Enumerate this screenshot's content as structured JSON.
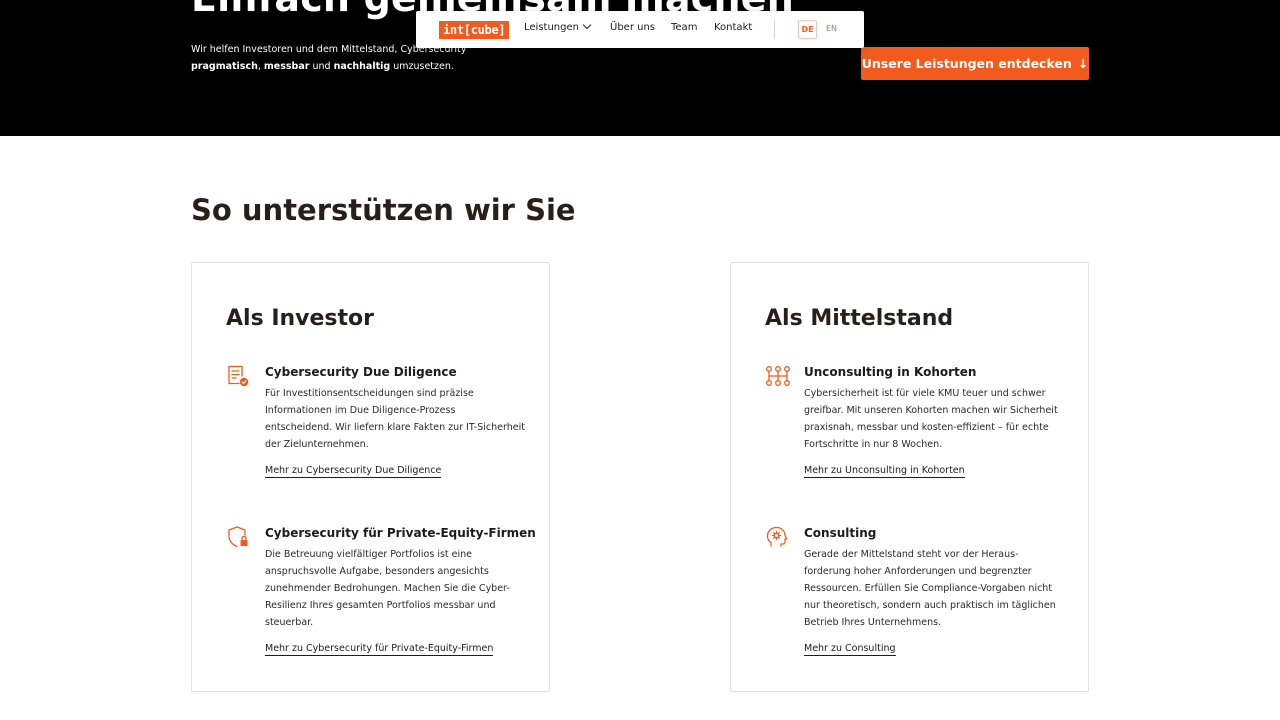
{
  "hero": {
    "title": "Einfach gemeinsam machen",
    "subtitle_part1": "Wir helfen Investoren und dem Mittelstand, Cybersecurity",
    "subtitle_bold1": "pragmatisch",
    "subtitle_sep1": ", ",
    "subtitle_bold2": "messbar",
    "subtitle_sep2": " und ",
    "subtitle_bold3": "nachhaltig",
    "subtitle_part2": " umzusetzen.",
    "cta_label": "Unsere Leistungen entdecken",
    "cta_arrow": "↓"
  },
  "nav": {
    "logo": "int[cube]",
    "items": [
      "Leistungen",
      "Über uns",
      "Team",
      "Kontakt"
    ],
    "languages": [
      "DE",
      "EN"
    ],
    "active_language": "DE"
  },
  "section": {
    "title": "So unterstützen wir Sie"
  },
  "cards": [
    {
      "title": "Als Investor",
      "items": [
        {
          "icon": "document-check-icon",
          "heading": "Cybersecurity Due Diligence",
          "text": "Für Investitionsentscheidungen sind präzise Informationen im Due Diligence-Prozess entscheidend. Wir liefern klare Fakten zur IT-Sicherheit der Zielunternehmen.",
          "link": "Mehr zu Cybersecurity Due Diligence"
        },
        {
          "icon": "shield-lock-icon",
          "heading": "Cybersecurity für Private-Equity-Firmen",
          "text": "Die Betreuung vielfältiger Portfolios ist eine anspruchsvolle Aufgabe, besonders angesichts zunehmender Bedrohungen. Machen Sie die Cyber-Resilienz Ihres gesamten Portfolios messbar und steuerbar.",
          "link": "Mehr zu Cybersecurity für Private-Equity-Firmen"
        }
      ]
    },
    {
      "title": "Als Mittelstand",
      "items": [
        {
          "icon": "network-icon",
          "heading": "Unconsulting in Kohorten",
          "text": "Cybersicherheit ist für viele KMU teuer und schwer greifbar. Mit unseren Kohorten machen wir Sicherheit praxisnah, messbar und kosten-effizient – für echte Fortschritte in nur 8 Wochen.",
          "link": "Mehr zu Unconsulting in Kohorten"
        },
        {
          "icon": "head-gear-icon",
          "heading": "Consulting",
          "text": "Gerade der Mittelstand steht vor der Heraus-forderung hoher Anforderungen und begrenzter Ressourcen. Erfüllen Sie Compliance-Vorgaben nicht nur theoretisch, sondern auch praktisch im täglichen Betrieb Ihres Unternehmens.",
          "link": "Mehr zu Consulting"
        }
      ]
    }
  ],
  "colors": {
    "accent": "#f35a1d",
    "hero_bg": "#000000",
    "text": "#1c1c1c",
    "card_border": "#e2e2e2"
  }
}
